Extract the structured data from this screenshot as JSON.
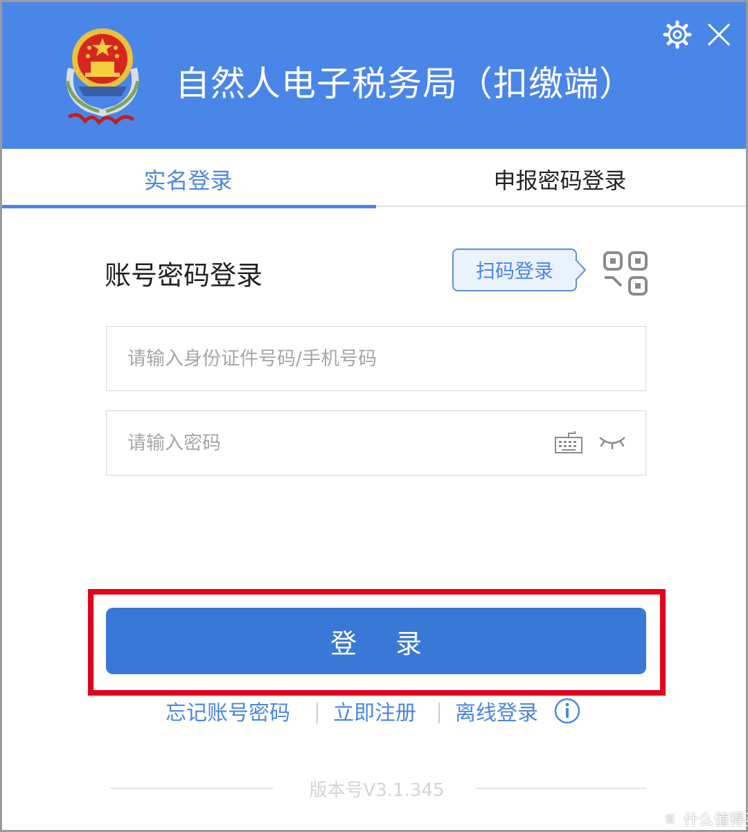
{
  "header": {
    "title": "自然人电子税务局（扣缴端）",
    "bg_color": "#4a86e8",
    "icons": [
      "emblem-icon",
      "gear-icon",
      "close-icon"
    ]
  },
  "tabs": [
    {
      "label": "实名登录",
      "active": true
    },
    {
      "label": "申报密码登录",
      "active": false
    }
  ],
  "form": {
    "title": "账号密码登录",
    "scan_label": "扫码登录",
    "id_placeholder": "请输入身份证件号码/手机号码",
    "id_value": "",
    "pwd_placeholder": "请输入密码",
    "pwd_value": ""
  },
  "login": {
    "label": "登 录",
    "highlight_color": "#e3001b",
    "button_color": "#3a78d8"
  },
  "links": {
    "forgot": "忘记账号密码",
    "register": "立即注册",
    "offline": "离线登录"
  },
  "footer": {
    "version": "版本号V3.1.345"
  },
  "watermark": {
    "text": "什么值得买"
  }
}
